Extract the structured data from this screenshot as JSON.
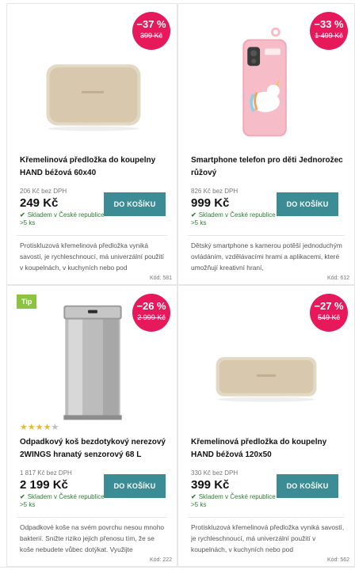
{
  "products": [
    {
      "discount": "−37 %",
      "old_price": "399 Kč",
      "title": "Křemelinová předložka do koupelny HAND béžová 60x40",
      "price_no_vat": "206 Kč bez DPH",
      "price": "249 Kč",
      "stock": "Skladem v České republice >5 ks",
      "button": "DO KOŠÍKU",
      "description": "Protiskluzová křemelinová předložka vyniká savostí, je rychleschnoucí, má univerzální použití v koupelnách, v kuchyních nebo pod",
      "code": "Kód: 581"
    },
    {
      "discount": "−33 %",
      "old_price": "1 499 Kč",
      "title": "Smartphone telefon pro děti Jednorožec růžový",
      "price_no_vat": "826 Kč bez DPH",
      "price": "999 Kč",
      "stock": "Skladem v České republice >5 ks",
      "button": "DO KOŠÍKU",
      "description": "Dětský smartphone s kamerou potěší jednoduchým ovládáním, vzdělávacími hrami a aplikacemi, které umožňují kreativní hraní,",
      "code": "Kód: 612"
    },
    {
      "tag": "Tip",
      "discount": "−26 %",
      "old_price": "2 999 Kč",
      "rating": 4,
      "rating_max": 5,
      "title": "Odpadkový koš bezdotykový nerezový 2WINGS hranatý senzorový 68 L",
      "price_no_vat": "1 817 Kč bez DPH",
      "price": "2 199 Kč",
      "stock": "Skladem v České republice >5 ks",
      "button": "DO KOŠÍKU",
      "description": "Odpadkové koše na svém povrchu nesou mnoho bakterií. Snižte riziko jejich přenosu tím, že se koše nebudete vůbec dotýkat. Využijte",
      "code": "Kód: 222"
    },
    {
      "discount": "−27 %",
      "old_price": "549 Kč",
      "title": "Křemelinová předložka do koupelny HAND béžová 120x50",
      "price_no_vat": "330 Kč bez DPH",
      "price": "399 Kč",
      "stock": "Skladem v České republice >5 ks",
      "button": "DO KOŠÍKU",
      "description": "Protiskluzová křemelinová předložka vyniká savostí, je rychleschnoucí, má univerzální použití v koupelnách, v kuchyních nebo pod",
      "code": "Kód: 562"
    }
  ],
  "colors": {
    "discount_badge": "#e6195a",
    "buy_button": "#3b8c94",
    "stock_text": "#2e7d32",
    "tip_tag": "#8bc53f",
    "star": "#e8b83a"
  },
  "icons": {
    "stock": "check-icon",
    "rating": "star-icon"
  }
}
